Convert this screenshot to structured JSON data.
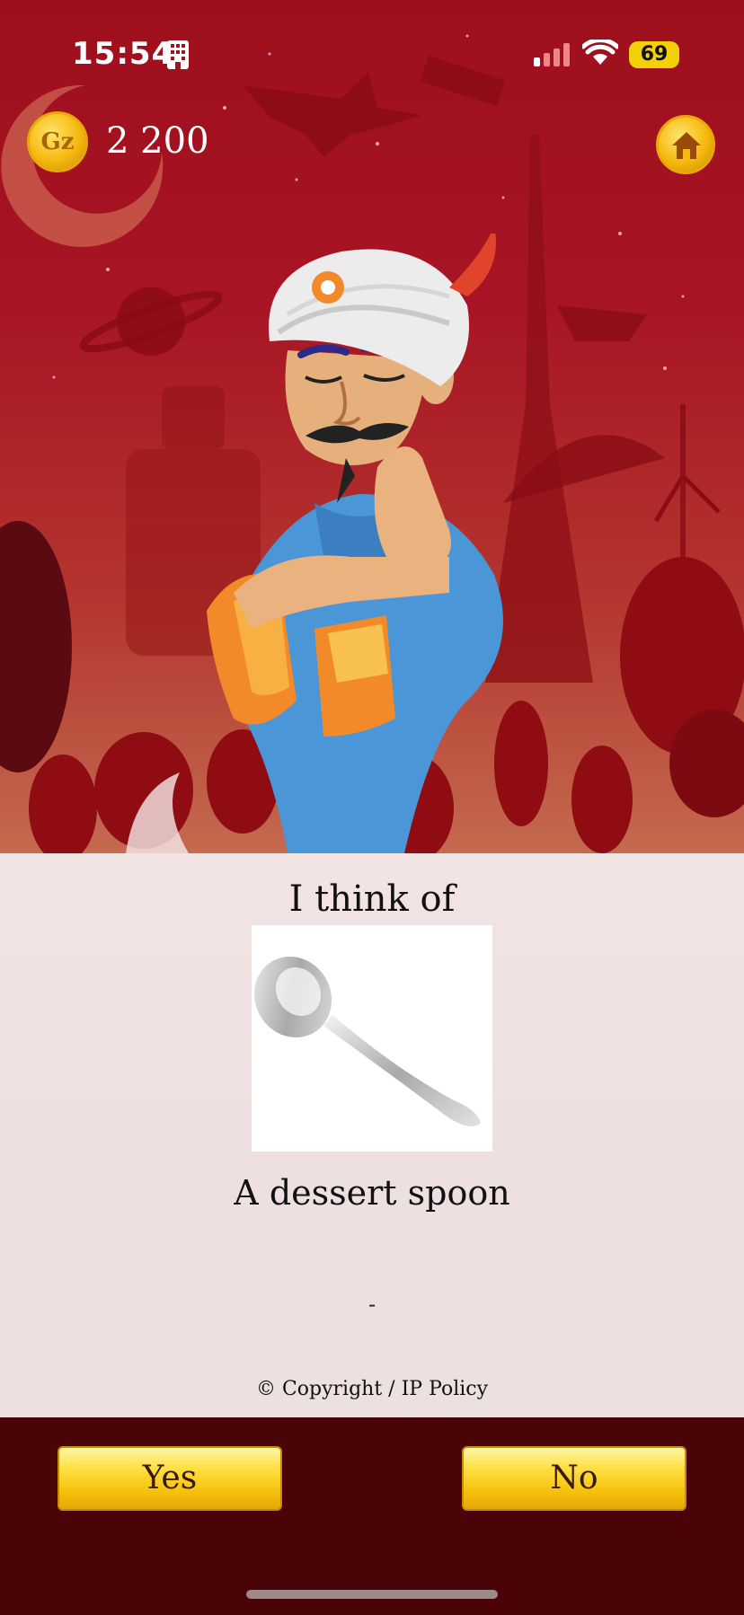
{
  "status_bar": {
    "time": "15:54",
    "battery": "69",
    "icons": [
      "building-icon",
      "signal-icon",
      "wifi-icon"
    ]
  },
  "header": {
    "coin_label": "Gz",
    "coins": "2 200",
    "home_icon": "home-icon"
  },
  "result": {
    "title": "I think of",
    "name": "A dessert spoon",
    "description": "-",
    "image": "spoon"
  },
  "footer": {
    "copyright": "© Copyright / IP Policy"
  },
  "answers": {
    "yes": "Yes",
    "no": "No"
  },
  "colors": {
    "background_red": "#a81424",
    "bar_dark": "#4a0408",
    "button_gold": "#f6c30c",
    "panel": "#eee0e0"
  }
}
